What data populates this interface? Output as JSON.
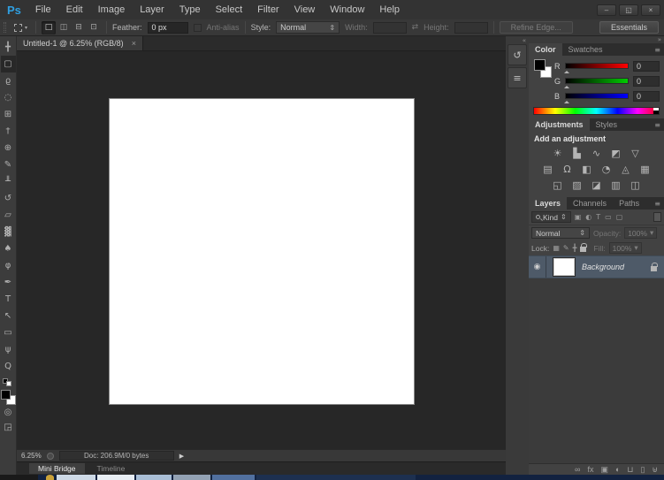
{
  "app": {
    "logo": "Ps"
  },
  "window_controls": {
    "minimize": "–",
    "restore": "◱",
    "close": "×"
  },
  "menu_bar": {
    "items": [
      "File",
      "Edit",
      "Image",
      "Layer",
      "Type",
      "Select",
      "Filter",
      "View",
      "Window",
      "Help"
    ]
  },
  "options_bar": {
    "preset_arrow": "▾",
    "selection_modes": [
      {
        "name": "new-selection",
        "glyph": "□",
        "selected": true
      },
      {
        "name": "add-to-selection",
        "glyph": "◫",
        "selected": false
      },
      {
        "name": "subtract-from-selection",
        "glyph": "⊟",
        "selected": false
      },
      {
        "name": "intersect-selection",
        "glyph": "⊡",
        "selected": false
      }
    ],
    "feather_label": "Feather:",
    "feather_value": "0 px",
    "antialias_label": "Anti-alias",
    "style_label": "Style:",
    "style_value": "Normal",
    "style_arrow": "⇕",
    "width_label": "Width:",
    "width_value": "",
    "swap_icon": "⇄",
    "height_label": "Height:",
    "height_value": "",
    "refine_edge_label": "Refine Edge...",
    "workspace_label": "Essentials"
  },
  "document": {
    "tab_title": "Untitled-1 @ 6.25% (RGB/8)",
    "tab_close": "×",
    "zoom_level": "6.25%",
    "doc_info": "Doc: 206.9M/0 bytes",
    "status_menu_icon": "▶"
  },
  "toolbar": {
    "tools": [
      {
        "name": "move",
        "glyph": "╋"
      },
      {
        "name": "rectangular-marquee",
        "glyph": "▢",
        "selected": true
      },
      {
        "name": "lasso",
        "glyph": "ϱ"
      },
      {
        "name": "quick-selection",
        "glyph": "◌"
      },
      {
        "name": "crop",
        "glyph": "⊞"
      },
      {
        "name": "eyedropper",
        "glyph": "†"
      },
      {
        "name": "spot-healing-brush",
        "glyph": "⊕"
      },
      {
        "name": "brush",
        "glyph": "✎"
      },
      {
        "name": "clone-stamp",
        "glyph": "╨"
      },
      {
        "name": "history-brush",
        "glyph": "↺"
      },
      {
        "name": "eraser",
        "glyph": "▱"
      },
      {
        "name": "gradient",
        "glyph": "▓"
      },
      {
        "name": "blur",
        "glyph": "♠"
      },
      {
        "name": "dodge",
        "glyph": "φ"
      },
      {
        "name": "pen",
        "glyph": "✒"
      },
      {
        "name": "type",
        "glyph": "T"
      },
      {
        "name": "path-selection",
        "glyph": "↖"
      },
      {
        "name": "rectangle",
        "glyph": "▭"
      },
      {
        "name": "hand",
        "glyph": "ψ"
      },
      {
        "name": "zoom",
        "glyph": "Q"
      }
    ],
    "quick_mask_glyph": "◎",
    "screen_mode_glyph": "◲",
    "foreground_color": "#000000",
    "background_color": "#ffffff"
  },
  "dock": {
    "collapse_icon_left": "«",
    "collapse_icon_right": "»",
    "icon_buttons": [
      {
        "name": "history",
        "glyph": "↺"
      },
      {
        "name": "properties",
        "glyph": "≡"
      }
    ]
  },
  "color_panel": {
    "tabs": [
      {
        "label": "Color",
        "active": true
      },
      {
        "label": "Swatches",
        "active": false
      }
    ],
    "menu_icon": "≡",
    "channels": [
      {
        "label": "R",
        "value": "0",
        "hex": "#ff0000"
      },
      {
        "label": "G",
        "value": "0",
        "hex": "#00c800"
      },
      {
        "label": "B",
        "value": "0",
        "hex": "#0000ff"
      }
    ]
  },
  "adjustments_panel": {
    "tabs": [
      {
        "label": "Adjustments",
        "active": true
      },
      {
        "label": "Styles",
        "active": false
      }
    ],
    "menu_icon": "≡",
    "heading": "Add an adjustment",
    "row1": [
      {
        "name": "brightness-contrast",
        "glyph": "☀"
      },
      {
        "name": "levels",
        "glyph": "▙"
      },
      {
        "name": "curves",
        "glyph": "∿"
      },
      {
        "name": "exposure",
        "glyph": "◩"
      },
      {
        "name": "vibrance",
        "glyph": "▽"
      }
    ],
    "row2": [
      {
        "name": "hue-saturation",
        "glyph": "▤"
      },
      {
        "name": "color-balance",
        "glyph": "Ω"
      },
      {
        "name": "black-and-white",
        "glyph": "◧"
      },
      {
        "name": "photo-filter",
        "glyph": "◔"
      },
      {
        "name": "channel-mixer",
        "glyph": "◬"
      },
      {
        "name": "color-lookup",
        "glyph": "▦"
      }
    ],
    "row3": [
      {
        "name": "invert",
        "glyph": "◱"
      },
      {
        "name": "posterize",
        "glyph": "▨"
      },
      {
        "name": "threshold",
        "glyph": "◪"
      },
      {
        "name": "gradient-map",
        "glyph": "▥"
      },
      {
        "name": "selective-color",
        "glyph": "◫"
      }
    ]
  },
  "layers_panel": {
    "tabs": [
      {
        "label": "Layers",
        "active": true
      },
      {
        "label": "Channels",
        "active": false
      },
      {
        "label": "Paths",
        "active": false
      }
    ],
    "menu_icon": "≡",
    "filter_label": "Kind",
    "filter_arrow": "⇕",
    "filter_icons": [
      {
        "name": "filter-pixel-layers",
        "glyph": "▣"
      },
      {
        "name": "filter-adjustment-layers",
        "glyph": "◐"
      },
      {
        "name": "filter-type-layers",
        "glyph": "T"
      },
      {
        "name": "filter-shape-layers",
        "glyph": "▭"
      },
      {
        "name": "filter-smart-objects",
        "glyph": "▢"
      }
    ],
    "blend_mode": "Normal",
    "blend_arrow": "⇕",
    "opacity_label": "Opacity:",
    "opacity_value": "100%",
    "opacity_arrow": "▾",
    "lock_label": "Lock:",
    "lock_icons": [
      {
        "name": "lock-transparent-pixels",
        "glyph": "▦"
      },
      {
        "name": "lock-image-pixels",
        "glyph": "✎"
      },
      {
        "name": "lock-position",
        "glyph": "╋"
      }
    ],
    "fill_label": "Fill:",
    "fill_value": "100%",
    "fill_arrow": "▾",
    "layer": {
      "name": "Background",
      "eye_glyph": "◉"
    },
    "bottom_icons": [
      {
        "name": "link-layers",
        "glyph": "∞"
      },
      {
        "name": "layer-effects",
        "glyph": "fx"
      },
      {
        "name": "add-layer-mask",
        "glyph": "▣"
      },
      {
        "name": "new-adjustment-layer",
        "glyph": "◐"
      },
      {
        "name": "new-group",
        "glyph": "⊔"
      },
      {
        "name": "new-layer",
        "glyph": "▯"
      },
      {
        "name": "delete-layer",
        "glyph": "⊎"
      }
    ]
  },
  "bottom_bar": {
    "tabs": [
      {
        "label": "Mini Bridge",
        "active": true
      },
      {
        "label": "Timeline",
        "active": false
      }
    ]
  },
  "colors": {
    "accent_blue": "#2f9fe0",
    "selected_layer": "#4e5a68",
    "canvas_bg": "#272727",
    "panel_bg": "#424242",
    "chrome_bg": "#383838"
  }
}
